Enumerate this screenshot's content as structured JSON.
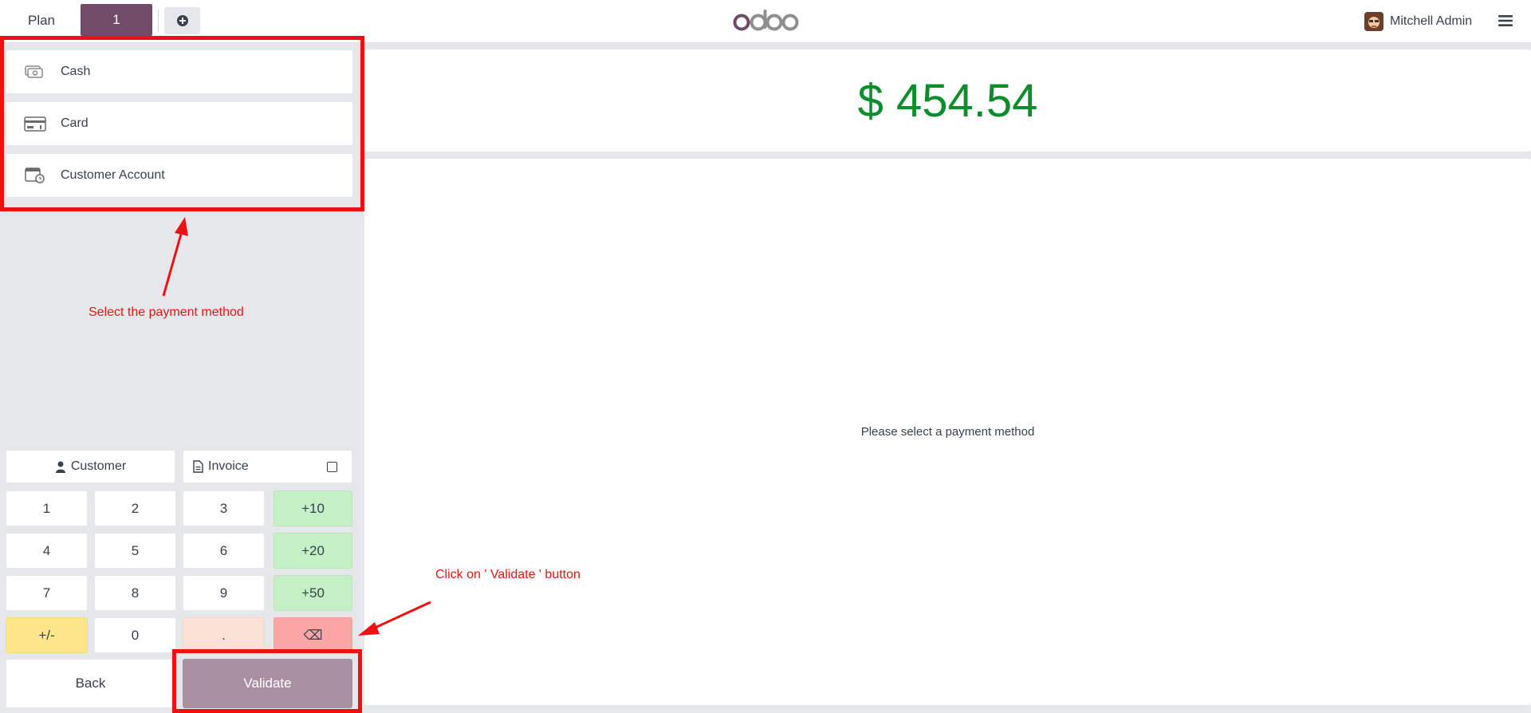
{
  "topbar": {
    "tab_plan": "Plan",
    "tab_order": "1",
    "logo_text": "odoo",
    "user_name": "Mitchell Admin"
  },
  "payment_methods": [
    {
      "label": "Cash",
      "icon": "cash-icon"
    },
    {
      "label": "Card",
      "icon": "card-icon"
    },
    {
      "label": "Customer Account",
      "icon": "customer-account-icon"
    }
  ],
  "actions": {
    "customer": "Customer",
    "invoice": "Invoice"
  },
  "numpad": {
    "k1": "1",
    "k2": "2",
    "k3": "3",
    "p10": "+10",
    "k4": "4",
    "k5": "5",
    "k6": "6",
    "p20": "+20",
    "k7": "7",
    "k8": "8",
    "k9": "9",
    "p50": "+50",
    "sign": "+/-",
    "k0": "0",
    "dot": ".",
    "backspace": "⌫"
  },
  "footer": {
    "back": "Back",
    "validate": "Validate"
  },
  "amount": "$ 454.54",
  "message": "Please select a payment method",
  "annotations": {
    "select_method": "Select the payment method",
    "click_validate": "Click on ' Validate ' button"
  },
  "colors": {
    "brand": "#714b67",
    "amount": "#0a8f2a",
    "annotation": "#ee1111",
    "validate_disabled": "#a88fa2"
  }
}
